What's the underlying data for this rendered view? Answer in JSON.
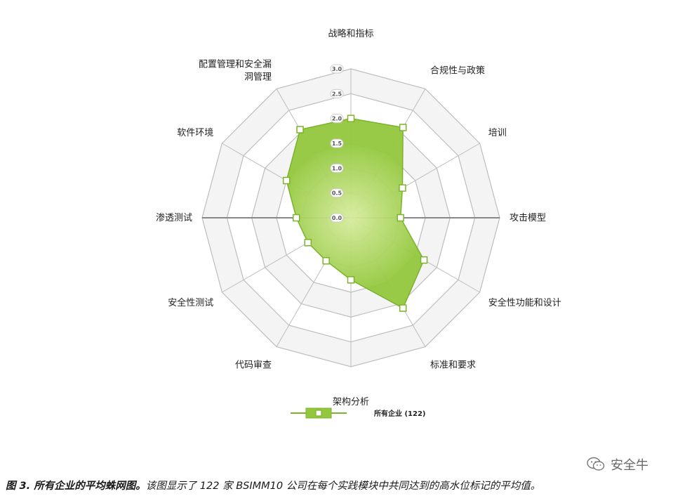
{
  "chart_data": {
    "type": "radar",
    "categories": [
      "战略和指标",
      "合规性与政策",
      "培训",
      "攻击模型",
      "安全性功能和设计",
      "标准和要求",
      "架构分析",
      "代码审查",
      "安全性测试",
      "渗透测试",
      "软件环境",
      "配置管理和安全漏洞管理"
    ],
    "category_lines": [
      [
        "战略和指标"
      ],
      [
        "合规性与政策"
      ],
      [
        "培训"
      ],
      [
        "攻击模型"
      ],
      [
        "安全性功能和设计"
      ],
      [
        "标准和要求"
      ],
      [
        "架构分析"
      ],
      [
        "代码审查"
      ],
      [
        "安全性测试"
      ],
      [
        "渗透测试"
      ],
      [
        "软件环境"
      ],
      [
        "配置管理和安全漏",
        "洞管理"
      ]
    ],
    "series": [
      {
        "name": "所有企业 (122)",
        "values": [
          2.0,
          2.1,
          1.2,
          1.0,
          1.7,
          2.1,
          1.25,
          1.0,
          1.0,
          1.1,
          1.5,
          2.05
        ]
      }
    ],
    "rlim": [
      0,
      3.0
    ],
    "ticks": [
      "0.0",
      "0.5",
      "1.0",
      "1.5",
      "2.0",
      "2.5",
      "3.0"
    ],
    "grid": true,
    "legend_position": "bottom"
  },
  "colors": {
    "fill": "#93c83e",
    "fill_center": "#d7ec9e",
    "stroke": "#7cb32c",
    "marker_fill": "#ffffff",
    "grid": "#bdbdbd",
    "axis": "#999999"
  },
  "caption": {
    "bold": "图 3. 所有企业的平均蛛网图。",
    "rest": "该图显示了 122 家 BSIMM10 公司在每个实践模块中共同达到的高水位标记的平均值。"
  },
  "watermark": {
    "text": "安全牛",
    "icon": "wechat-icon"
  }
}
